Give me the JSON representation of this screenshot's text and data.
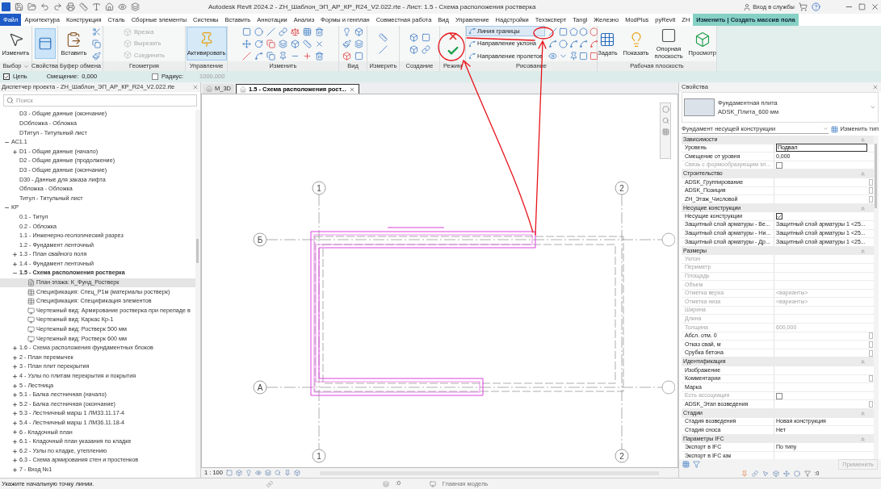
{
  "window": {
    "title": "Autodesk Revit 2024.2 - ZH_Шаблон_ЭП_АР_КР_R24_V2.022.rte - Лист: 1.5 - Схема расположения ростверка",
    "sign_in": "Вход в службы"
  },
  "menu_tabs": [
    {
      "label": "Файл",
      "kind": "file",
      "selected": false
    },
    {
      "label": "Архитектура",
      "kind": "tab",
      "selected": false
    },
    {
      "label": "Конструкция",
      "kind": "tab",
      "selected": false
    },
    {
      "label": "Сталь",
      "kind": "tab",
      "selected": false
    },
    {
      "label": "Сборные элементы",
      "kind": "tab",
      "selected": false
    },
    {
      "label": "Системы",
      "kind": "tab",
      "selected": false
    },
    {
      "label": "Вставить",
      "kind": "tab",
      "selected": false
    },
    {
      "label": "Аннотации",
      "kind": "tab",
      "selected": false
    },
    {
      "label": "Анализ",
      "kind": "tab",
      "selected": false
    },
    {
      "label": "Формы и генплан",
      "kind": "tab",
      "selected": false
    },
    {
      "label": "Совместная работа",
      "kind": "tab",
      "selected": false
    },
    {
      "label": "Вид",
      "kind": "tab",
      "selected": false
    },
    {
      "label": "Управление",
      "kind": "tab",
      "selected": false
    },
    {
      "label": "Надстройки",
      "kind": "tab",
      "selected": false
    },
    {
      "label": "Техэксперт",
      "kind": "tab",
      "selected": false
    },
    {
      "label": "Tangl",
      "kind": "tab",
      "selected": false
    },
    {
      "label": "Железно",
      "kind": "tab",
      "selected": false
    },
    {
      "label": "ModPlus",
      "kind": "tab",
      "selected": false
    },
    {
      "label": "pyRevit",
      "kind": "tab",
      "selected": false
    },
    {
      "label": "ZH",
      "kind": "tab",
      "selected": false
    },
    {
      "label": "Изменить | Создать массив пола",
      "kind": "contextual",
      "selected": true
    }
  ],
  "ribbon": {
    "panels": [
      {
        "kind": "select",
        "label": "Выбор",
        "dropdown": true,
        "buttons": [
          {
            "label": "Изменить"
          }
        ]
      },
      {
        "kind": "properties",
        "label": "Свойства",
        "dropdown": false
      },
      {
        "kind": "clipboard",
        "label": "Буфер обмена",
        "dropdown": false,
        "buttons": [
          {
            "label": "Вставить"
          }
        ]
      },
      {
        "kind": "geometry",
        "label": "Геометрия",
        "dropdown": false,
        "buttons": [
          {
            "label": "Врезка",
            "disabled": true
          },
          {
            "label": "Вырезать",
            "disabled": true
          },
          {
            "label": "Соединить",
            "disabled": true
          }
        ]
      },
      {
        "kind": "control",
        "label": "Управление",
        "dropdown": false,
        "buttons": [
          {
            "label": "Активировать",
            "highlighted": true
          }
        ]
      },
      {
        "kind": "modify",
        "label": "Изменить",
        "dropdown": false
      },
      {
        "kind": "view",
        "label": "Вид",
        "dropdown": false
      },
      {
        "kind": "measure",
        "label": "Измерить",
        "dropdown": false
      },
      {
        "kind": "create",
        "label": "Создание",
        "dropdown": false
      },
      {
        "kind": "mode",
        "label": "Режим",
        "dropdown": false
      },
      {
        "kind": "draw",
        "label": "Рисование",
        "dropdown": false,
        "buttons": [
          {
            "label": "Линия границы",
            "selected": true
          },
          {
            "label": "Направление уклона",
            "selected": false
          },
          {
            "label": "Направление пролетов",
            "selected": false
          }
        ]
      },
      {
        "kind": "workplane",
        "label": "Рабочая плоскость",
        "dropdown": false,
        "buttons": [
          {
            "label": "Задать"
          },
          {
            "label": "Показать"
          },
          {
            "label": "Опорная плоскость"
          },
          {
            "label": "Просмотр"
          }
        ]
      }
    ]
  },
  "options_bar": {
    "chain": {
      "label": "Цепь",
      "checked": true
    },
    "offset": {
      "label": "Смещение:",
      "value": "0,000"
    },
    "radius": {
      "label": "Радиус:",
      "checked": false,
      "value": "1000,000"
    }
  },
  "project_browser": {
    "title": "Диспетчер проекта - ZH_Шаблон_ЭП_АР_КР_R24_V2.022.rte",
    "search_placeholder": "Поиск",
    "continued_items": [
      {
        "label": "D3 - Общие данные (окончание)",
        "selected": false
      },
      {
        "label": "DОбложка - Обложка",
        "selected": false
      },
      {
        "label": "DТитул - Титульный лист",
        "selected": false
      }
    ],
    "tree": [
      {
        "label": "АС1.1",
        "expanded": true,
        "selected": false,
        "children": [
          {
            "label": "D1 - Общие данные (начало)",
            "expanded": false,
            "selected": false
          },
          {
            "label": "D2 - Общие данные (продолжение)",
            "selected": false
          },
          {
            "label": "D3 - Общие данные (окончание)",
            "selected": false
          },
          {
            "label": "D30 - Данные для заказа лифта",
            "selected": false
          },
          {
            "label": "Обложка - Обложка",
            "selected": false
          },
          {
            "label": "Титул - Титульный лист",
            "selected": false
          }
        ]
      },
      {
        "label": "КР",
        "expanded": true,
        "selected": false,
        "children": [
          {
            "label": "0.1 - Титул",
            "selected": false
          },
          {
            "label": "0.2 - Обложка",
            "selected": false
          },
          {
            "label": "1.1 - Инженерно-геологический разрез",
            "selected": false
          },
          {
            "label": "1.2 - Фундамент ленточный",
            "selected": false
          },
          {
            "label": "1.3 - План свайного поля",
            "expanded": false,
            "selected": false
          },
          {
            "label": "1.4 - Фундамент ленточный",
            "expanded": false,
            "selected": false
          },
          {
            "label": "1.5 - Схема расположения ростверка",
            "kind": "active_sheet",
            "expanded": true,
            "selected": false,
            "children": [
              {
                "label": "План этажа: К_Фунд_Ростверк",
                "kind": "plan",
                "selected": true
              },
              {
                "label": "Спецификация: Спец_Р1м (материалы ростверк)",
                "kind": "schedule",
                "selected": false
              },
              {
                "label": "Спецификация: Спецификация элементов",
                "kind": "schedule",
                "selected": false
              },
              {
                "label": "Чертежный вид: Армирование ростверка при перепаде в",
                "kind": "drafting",
                "selected": false
              },
              {
                "label": "Чертежный вид: Каркас Кр-1",
                "kind": "drafting",
                "selected": false
              },
              {
                "label": "Чертежный вид: Ростверк 500 мм",
                "kind": "drafting",
                "selected": false
              },
              {
                "label": "Чертежный вид: Ростверк 600 мм",
                "kind": "drafting",
                "selected": false
              }
            ]
          },
          {
            "label": "1.6 - Схема расположения фундаментных блоков",
            "expanded": false,
            "selected": false
          },
          {
            "label": "2 - План перемычек",
            "expanded": false,
            "selected": false
          },
          {
            "label": "3 - План плит перекрытия",
            "expanded": false,
            "selected": false
          },
          {
            "label": "4 - Узлы по плитам перекрытия и покрытия",
            "expanded": false,
            "selected": false
          },
          {
            "label": "5 - Лестница",
            "expanded": false,
            "selected": false
          },
          {
            "label": "5.1 - Балка лестничная (начало)",
            "expanded": false,
            "selected": false
          },
          {
            "label": "5.2 - Балка лестничная (окончание)",
            "expanded": false,
            "selected": false
          },
          {
            "label": "5.3 - Лестничный марш 1 ЛМ33.11.17-4",
            "expanded": false,
            "selected": false
          },
          {
            "label": "5.4 - Лестничный марш 1 ЛМ36.11.18-4",
            "expanded": false,
            "selected": false
          },
          {
            "label": "6 - Кладочный план",
            "expanded": false,
            "selected": false
          },
          {
            "label": "6.1 - Кладочный план указания по кладке",
            "expanded": false,
            "selected": false
          },
          {
            "label": "6.2 - Узлы по кладке, утеплению",
            "expanded": false,
            "selected": false
          },
          {
            "label": "6.3 - Схема армирования стен и простенков",
            "expanded": false,
            "selected": false
          },
          {
            "label": "7 - Вход №1",
            "expanded": false,
            "selected": false
          }
        ]
      }
    ]
  },
  "canvas": {
    "tabs": [
      {
        "label": "M_3D",
        "selected": false
      },
      {
        "label": "1.5 - Схема расположения рост...",
        "selected": true
      }
    ],
    "grid_labels": [
      {
        "label": "1",
        "kind": "top"
      },
      {
        "label": "2",
        "kind": "top"
      },
      {
        "label": "Б",
        "kind": "left"
      },
      {
        "label": "А",
        "kind": "left"
      },
      {
        "label": "1",
        "kind": "bottom"
      },
      {
        "label": "2",
        "kind": "bottom"
      }
    ],
    "scale": "1 : 100"
  },
  "properties": {
    "title": "Свойства",
    "type_family": "Фундаментная плита",
    "type_name": "ADSK_Плита_600 мм",
    "filter": "Фундамент несущей конструкции",
    "edit_type": "Изменить тип",
    "groups": [
      {
        "label": "Зависимости",
        "expanded": true,
        "rows": [
          {
            "name": "Уровень",
            "value": "Подвал",
            "kind": "input",
            "disabled": false,
            "button": false
          },
          {
            "name": "Смещение от уровня",
            "value": "0,000",
            "kind": "text",
            "disabled": false,
            "button": false
          },
          {
            "name": "Связь с формообразующим эл...",
            "kind": "checkbox",
            "checked": false,
            "disabled": true,
            "button": false
          }
        ]
      },
      {
        "label": "Строительство",
        "expanded": true,
        "rows": [
          {
            "name": "ADSK_Группирование",
            "kind": "text",
            "disabled": false,
            "button": true
          },
          {
            "name": "ADSK_Позиция",
            "kind": "text",
            "disabled": false,
            "button": true
          },
          {
            "name": "ZH_Этаж_Числовой",
            "kind": "text",
            "disabled": false,
            "button": true
          }
        ]
      },
      {
        "label": "Несущие конструкции",
        "expanded": true,
        "rows": [
          {
            "name": "Несущие конструкции",
            "kind": "checkbox",
            "checked": true,
            "disabled": false,
            "button": false
          },
          {
            "name": "Защитный слой арматуры - Ве...",
            "value": "Защитный слой арматуры 1 <25...",
            "kind": "text",
            "disabled": false,
            "button": false
          },
          {
            "name": "Защитный слой арматуры - Ни...",
            "value": "Защитный слой арматуры 1 <25...",
            "kind": "text",
            "disabled": false,
            "button": false
          },
          {
            "name": "Защитный слой арматуры - Др...",
            "value": "Защитный слой арматуры 1 <25...",
            "kind": "text",
            "disabled": false,
            "button": false
          }
        ]
      },
      {
        "label": "Размеры",
        "expanded": true,
        "rows": [
          {
            "name": "Уклон",
            "kind": "text",
            "disabled": true,
            "button": false
          },
          {
            "name": "Периметр",
            "kind": "text",
            "disabled": true,
            "button": false
          },
          {
            "name": "Площадь",
            "kind": "text",
            "disabled": true,
            "button": false
          },
          {
            "name": "Объем",
            "kind": "text",
            "disabled": true,
            "button": false
          },
          {
            "name": "Отметка верха",
            "value": "<варианты>",
            "kind": "text",
            "disabled": true,
            "button": false
          },
          {
            "name": "Отметка низа",
            "value": "<варианты>",
            "kind": "text",
            "disabled": true,
            "button": false
          },
          {
            "name": "Ширина",
            "kind": "text",
            "disabled": true,
            "button": false
          },
          {
            "name": "Длина",
            "kind": "text",
            "disabled": true,
            "button": false
          },
          {
            "name": "Толщина",
            "value": "600,000",
            "kind": "text",
            "disabled": true,
            "button": false
          },
          {
            "name": "Абсл. отм. 0",
            "kind": "text",
            "disabled": false,
            "button": true
          },
          {
            "name": "Отказ свай, м",
            "kind": "text",
            "disabled": false,
            "button": true
          },
          {
            "name": "Срубка бетона",
            "kind": "text",
            "disabled": false,
            "button": true
          }
        ]
      },
      {
        "label": "Идентификация",
        "expanded": true,
        "rows": [
          {
            "name": "Изображение",
            "kind": "text",
            "disabled": false,
            "button": false
          },
          {
            "name": "Комментарии",
            "kind": "text",
            "disabled": false,
            "button": true
          },
          {
            "name": "Марка",
            "kind": "text",
            "disabled": false,
            "button": false
          },
          {
            "name": "Есть ассоциация",
            "kind": "checkbox",
            "checked": false,
            "disabled": true,
            "button": false
          },
          {
            "name": "ADSK_Этап возведения",
            "kind": "text",
            "disabled": false,
            "button": true
          }
        ]
      },
      {
        "label": "Стадии",
        "expanded": true,
        "rows": [
          {
            "name": "Стадия возведения",
            "value": "Новая конструкция",
            "kind": "text",
            "disabled": false,
            "button": false
          },
          {
            "name": "Стадия сноса",
            "value": "Нет",
            "kind": "text",
            "disabled": false,
            "button": false
          }
        ]
      },
      {
        "label": "Параметры IFC",
        "expanded": true,
        "rows": [
          {
            "name": "Экспорт в IFC",
            "value": "По типу",
            "kind": "text",
            "disabled": false,
            "button": false
          },
          {
            "name": "Экспорт в IFC как",
            "kind": "text",
            "disabled": false,
            "button": false
          }
        ]
      }
    ],
    "apply": {
      "label": "Применить",
      "disabled": true
    },
    "selection_count": ":0"
  },
  "status_bar": {
    "hint": "Укажите начальную точку линии.",
    "worksets": ":0",
    "model": "Главная модель"
  }
}
